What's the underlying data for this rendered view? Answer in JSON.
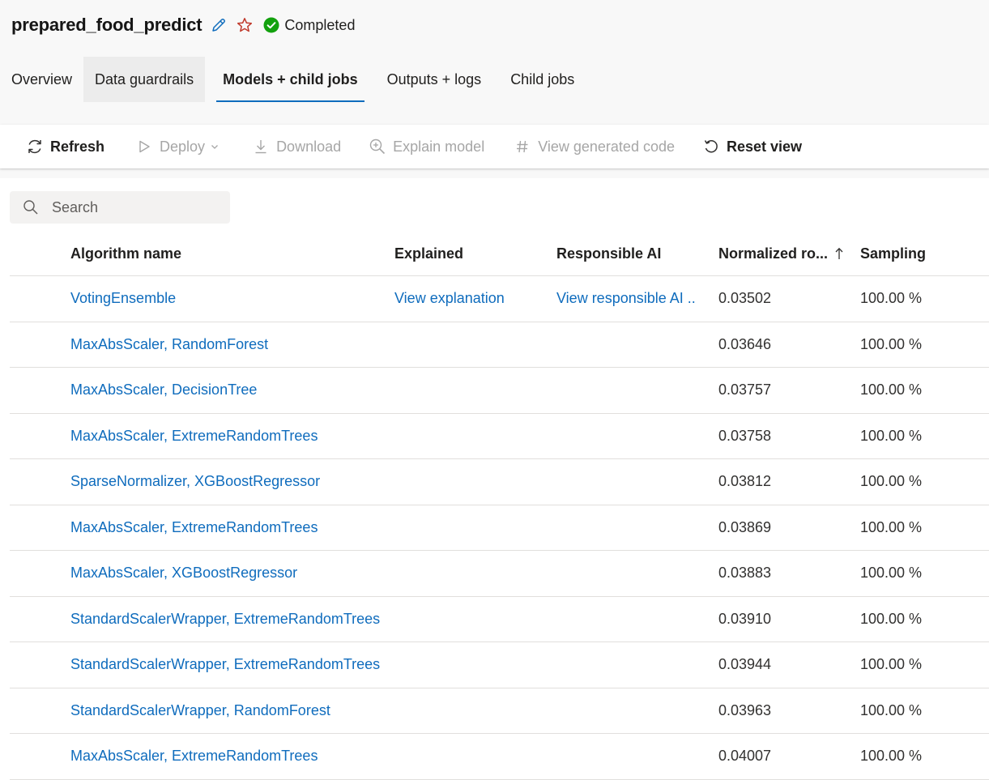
{
  "header": {
    "title": "prepared_food_predict",
    "status_label": "Completed",
    "status_color": "#13a10e",
    "edit_icon": "pencil-icon",
    "favorite_icon": "star-icon"
  },
  "tabs": [
    {
      "label": "Overview"
    },
    {
      "label": "Data guardrails"
    },
    {
      "label": "Models + child jobs"
    },
    {
      "label": "Outputs + logs"
    },
    {
      "label": "Child jobs"
    }
  ],
  "tabs_state": {
    "active": "Models + child jobs",
    "hovered": "Data guardrails"
  },
  "toolbar": {
    "refresh": "Refresh",
    "deploy": "Deploy",
    "download": "Download",
    "explain_model": "Explain model",
    "view_generated_code": "View generated code",
    "reset_view": "Reset view"
  },
  "search": {
    "placeholder": "Search",
    "value": ""
  },
  "table": {
    "headers": {
      "algorithm": "Algorithm name",
      "explained": "Explained",
      "responsible_ai": "Responsible AI",
      "normalized": "Normalized ro...",
      "sampling": "Sampling"
    },
    "sort": {
      "column": "normalized",
      "direction": "ascending"
    },
    "rows": [
      {
        "algorithm": "VotingEnsemble",
        "explained": "View explanation",
        "responsible_ai": "View responsible AI ...",
        "normalized": "0.03502",
        "sampling": "100.00 %"
      },
      {
        "algorithm": "MaxAbsScaler, RandomForest",
        "explained": "",
        "responsible_ai": "",
        "normalized": "0.03646",
        "sampling": "100.00 %"
      },
      {
        "algorithm": "MaxAbsScaler, DecisionTree",
        "explained": "",
        "responsible_ai": "",
        "normalized": "0.03757",
        "sampling": "100.00 %"
      },
      {
        "algorithm": "MaxAbsScaler, ExtremeRandomTrees",
        "explained": "",
        "responsible_ai": "",
        "normalized": "0.03758",
        "sampling": "100.00 %"
      },
      {
        "algorithm": "SparseNormalizer, XGBoostRegressor",
        "explained": "",
        "responsible_ai": "",
        "normalized": "0.03812",
        "sampling": "100.00 %"
      },
      {
        "algorithm": "MaxAbsScaler, ExtremeRandomTrees",
        "explained": "",
        "responsible_ai": "",
        "normalized": "0.03869",
        "sampling": "100.00 %"
      },
      {
        "algorithm": "MaxAbsScaler, XGBoostRegressor",
        "explained": "",
        "responsible_ai": "",
        "normalized": "0.03883",
        "sampling": "100.00 %"
      },
      {
        "algorithm": "StandardScalerWrapper, ExtremeRandomTrees",
        "explained": "",
        "responsible_ai": "",
        "normalized": "0.03910",
        "sampling": "100.00 %"
      },
      {
        "algorithm": "StandardScalerWrapper, ExtremeRandomTrees",
        "explained": "",
        "responsible_ai": "",
        "normalized": "0.03944",
        "sampling": "100.00 %"
      },
      {
        "algorithm": "StandardScalerWrapper, RandomForest",
        "explained": "",
        "responsible_ai": "",
        "normalized": "0.03963",
        "sampling": "100.00 %"
      },
      {
        "algorithm": "MaxAbsScaler, ExtremeRandomTrees",
        "explained": "",
        "responsible_ai": "",
        "normalized": "0.04007",
        "sampling": "100.00 %"
      }
    ]
  },
  "colors": {
    "link": "#0f6cbd",
    "accent": "#0f6cbd",
    "disabled": "#a6a6a6",
    "star": "#c0392b"
  }
}
